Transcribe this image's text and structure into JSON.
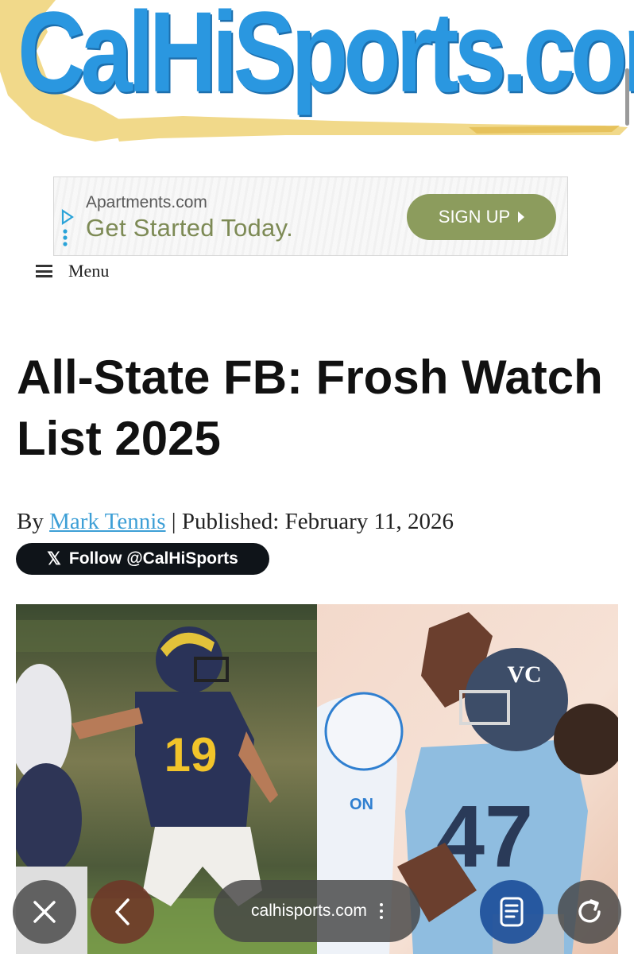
{
  "logo": {
    "text": "CalHiSports.com"
  },
  "ad": {
    "brand": "Apartments.com",
    "headline": "Get Started Today.",
    "cta_label": "SIGN UP"
  },
  "menu": {
    "label": "Menu"
  },
  "article": {
    "title": "All-State FB: Frosh Watch List 2025",
    "byline_prefix": "By",
    "author": "Mark Tennis",
    "separator": "|",
    "published_label": "Published:",
    "published_date": "February 11, 2026",
    "follow_label": "Follow @CalHiSports",
    "left_jersey_number": "19",
    "right_jersey_number": "47",
    "helmet_logo_text": "VC",
    "side_text": "ON"
  },
  "browser": {
    "url": "calhisports.com"
  },
  "colors": {
    "logo_blue": "#2a97e0",
    "map_gold": "#f1d98a",
    "ad_green": "#8c9c5d",
    "link_blue": "#3d9fd6",
    "toolbar": "#464646",
    "reader_blue": "#1d4f9a"
  },
  "icons": {
    "close": "close-icon",
    "back": "chevron-left-icon",
    "more": "more-vertical-icon",
    "reader": "reader-icon",
    "reload": "reload-icon",
    "x": "x-logo-icon",
    "menu": "hamburger-icon",
    "ad_choices": "ad-choices-icon"
  }
}
